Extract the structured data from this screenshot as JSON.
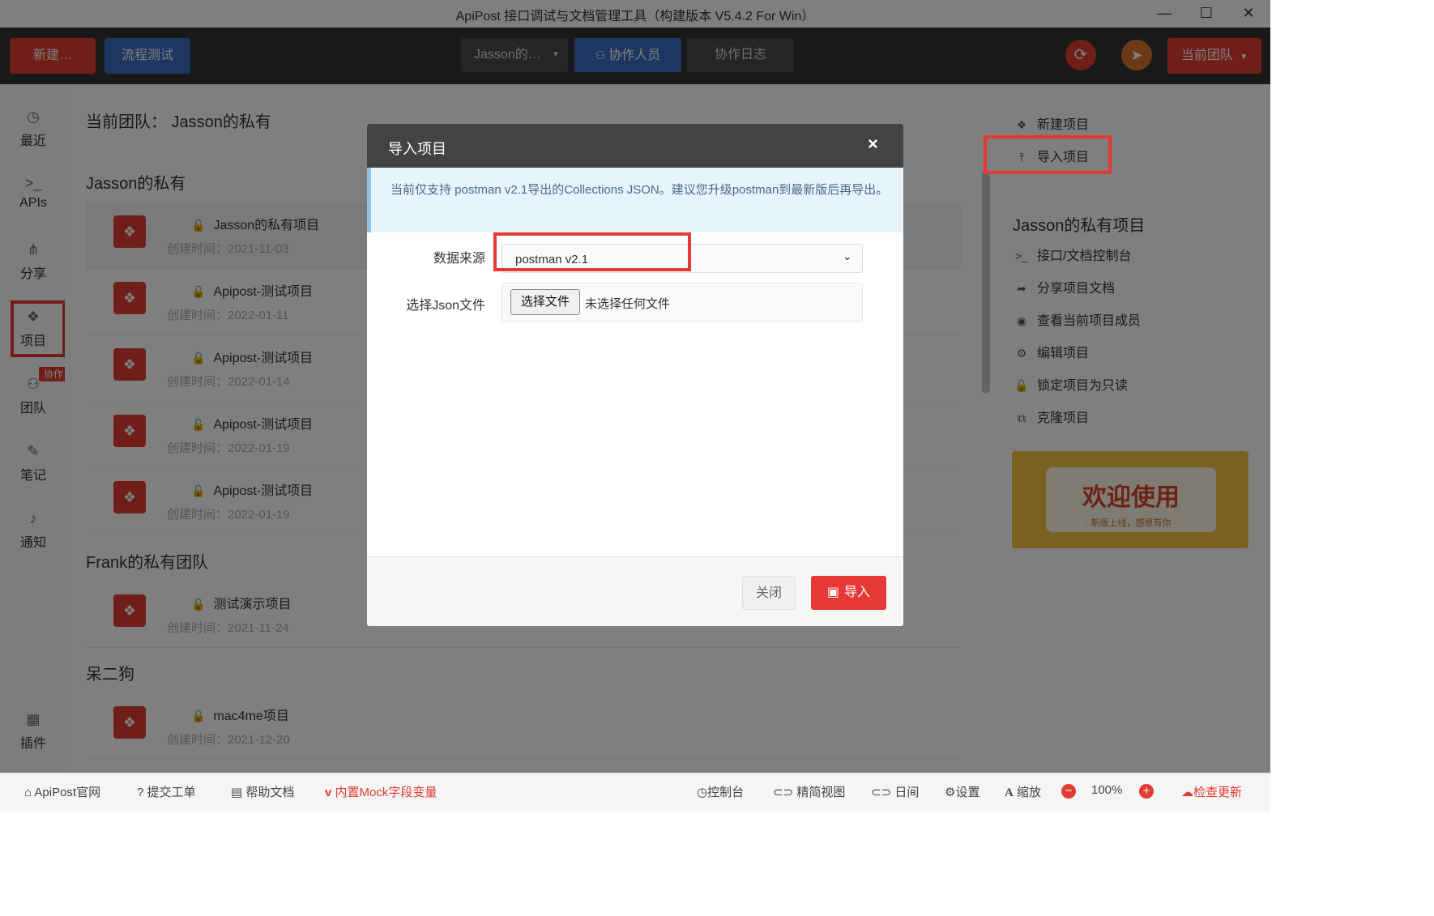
{
  "window": {
    "title": "ApiPost 接口调试与文档管理工具（构建版本 V5.4.2 For Win）",
    "controls": [
      "—",
      "☐",
      "✕"
    ]
  },
  "topnav": {
    "new_label": "新建…",
    "flow_label": "流程测试",
    "project_select": "Jasson的…",
    "collab_members_label": "协作人员",
    "collab_log_label": "协作日志",
    "current_team_label": "当前团队"
  },
  "sidebar": {
    "items": [
      {
        "label": "最近",
        "icon": "clock-icon",
        "glyph": "◷"
      },
      {
        "label": "APIs",
        "icon": "terminal-icon",
        "glyph": ">_"
      },
      {
        "label": "分享",
        "icon": "share-icon",
        "glyph": "⋔"
      },
      {
        "label": "项目",
        "icon": "cubes-icon",
        "glyph": "❖"
      },
      {
        "label": "团队",
        "icon": "sitemap-icon",
        "glyph": "⚇",
        "badge": "协作"
      },
      {
        "label": "笔记",
        "icon": "edit-icon",
        "glyph": "✎"
      },
      {
        "label": "通知",
        "icon": "bell-icon",
        "glyph": "♪"
      },
      {
        "label": "插件",
        "icon": "grid-icon",
        "glyph": "▦"
      }
    ]
  },
  "main": {
    "header": "当前团队：  Jasson的私有",
    "groups": [
      {
        "title": "Jasson的私有",
        "projects": [
          {
            "name": "Jasson的私有项目",
            "date": "创建时间：2021-11-03"
          },
          {
            "name": "Apipost-测试项目",
            "date": "创建时间：2022-01-11"
          },
          {
            "name": "Apipost-测试项目",
            "date": "创建时间：2022-01-14"
          },
          {
            "name": "Apipost-测试项目",
            "date": "创建时间：2022-01-19"
          },
          {
            "name": "Apipost-测试项目",
            "date": "创建时间：2022-01-19"
          }
        ]
      },
      {
        "title": "Frank的私有团队",
        "projects": [
          {
            "name": "测试演示项目",
            "date": "创建时间：2021-11-24"
          }
        ]
      },
      {
        "title": "呆二狗",
        "projects": [
          {
            "name": "mac4me项目",
            "date": "创建时间：2021-12-20"
          }
        ]
      }
    ]
  },
  "right_panel": {
    "new_project": "新建项目",
    "import_project": "导入项目",
    "project_title": "Jasson的私有项目",
    "actions": [
      {
        "label": "接口/文档控制台",
        "icon": "terminal-icon",
        "glyph": ">_"
      },
      {
        "label": "分享项目文档",
        "icon": "share-arrow-icon",
        "glyph": "➦"
      },
      {
        "label": "查看当前项目成员",
        "icon": "eye-icon",
        "glyph": "◉"
      },
      {
        "label": "编辑项目",
        "icon": "gear-icon",
        "glyph": "⚙"
      },
      {
        "label": "锁定项目为只读",
        "icon": "lock-icon",
        "glyph": "🔓"
      },
      {
        "label": "克隆项目",
        "icon": "clone-icon",
        "glyph": "⧉"
      }
    ],
    "banner_title": "欢迎使用",
    "banner_sub": "· 新版上线，感恩有你 ·"
  },
  "modal": {
    "title": "导入项目",
    "close": "×",
    "notice": "当前仅支持 postman v2.1导出的Collections JSON。建议您升级postman到最新版后再导出。",
    "source_label": "数据来源",
    "source_value": "postman v2.1",
    "file_label": "选择Json文件",
    "file_button": "选择文件",
    "file_status": "未选择任何文件",
    "cancel_label": "关闭",
    "import_label": "导入"
  },
  "statusbar": {
    "official": "ApiPost官网",
    "ticket": "提交工单",
    "help": "帮助文档",
    "mock": "内置Mock字段变量",
    "console": "控制台",
    "simple_view": "精简视图",
    "day": "日间",
    "settings": "设置",
    "zoom": "缩放",
    "zoom_value": "100%",
    "update": "检查更新"
  },
  "colors": {
    "red": "#e03c31",
    "blue": "#3a6fc4",
    "dark": "#333333"
  }
}
